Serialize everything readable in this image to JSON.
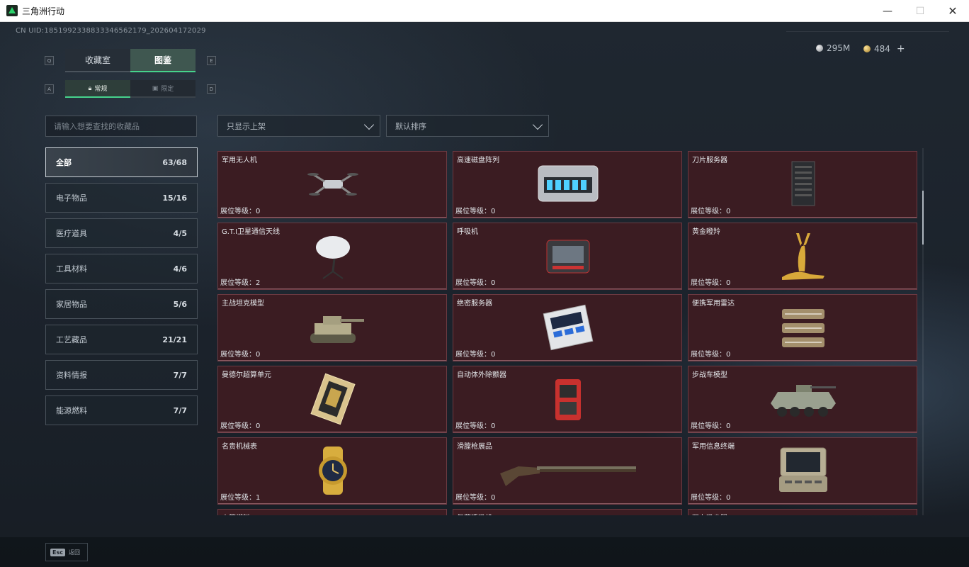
{
  "window": {
    "title": "三角洲行动",
    "min": "—",
    "max": "☐",
    "close": "✕"
  },
  "header": {
    "uid": "CN UID:1851992338833346562179_202604172029"
  },
  "currency": {
    "silver": "295M",
    "gold": "484",
    "plus": "+"
  },
  "keys": {
    "q": "Q",
    "e": "E",
    "a": "A",
    "d": "D"
  },
  "tabs": [
    {
      "label": "收藏室"
    },
    {
      "label": "图鉴"
    }
  ],
  "subtabs": [
    {
      "label": "常规",
      "icon": "lock-icon"
    },
    {
      "label": "限定",
      "icon": "image-icon"
    }
  ],
  "search": {
    "placeholder": "请输入想要查找的收藏品"
  },
  "filters": {
    "display": "只显示上架",
    "sort": "默认排序"
  },
  "categories": [
    {
      "label": "全部",
      "count": "63/68"
    },
    {
      "label": "电子物品",
      "count": "15/16"
    },
    {
      "label": "医疗道具",
      "count": "4/5"
    },
    {
      "label": "工具材料",
      "count": "4/6"
    },
    {
      "label": "家居物品",
      "count": "5/6"
    },
    {
      "label": "工艺藏品",
      "count": "21/21"
    },
    {
      "label": "资料情报",
      "count": "7/7"
    },
    {
      "label": "能源燃料",
      "count": "7/7"
    }
  ],
  "level_prefix": "展位等级：",
  "items": [
    {
      "name": "军用无人机",
      "level": "0",
      "icon": "drone-icon"
    },
    {
      "name": "高速磁盘阵列",
      "level": "0",
      "icon": "disk-array-icon"
    },
    {
      "name": "刀片服务器",
      "level": "0",
      "icon": "blade-server-icon"
    },
    {
      "name": "G.T.I卫星通信天线",
      "level": "2",
      "icon": "satellite-dish-icon"
    },
    {
      "name": "呼吸机",
      "level": "0",
      "icon": "ventilator-icon"
    },
    {
      "name": "黄金瞪羚",
      "level": "0",
      "icon": "gold-gazelle-icon"
    },
    {
      "name": "主战坦克模型",
      "level": "0",
      "icon": "tank-model-icon"
    },
    {
      "name": "绝密服务器",
      "level": "0",
      "icon": "secret-server-icon"
    },
    {
      "name": "便携军用雷达",
      "level": "0",
      "icon": "radar-icon"
    },
    {
      "name": "曼德尔超算单元",
      "level": "0",
      "icon": "supercomputer-unit-icon"
    },
    {
      "name": "自动体外除颤器",
      "level": "0",
      "icon": "defibrillator-icon"
    },
    {
      "name": "步战车模型",
      "level": "0",
      "icon": "ifv-model-icon"
    },
    {
      "name": "名贵机械表",
      "level": "1",
      "icon": "watch-icon"
    },
    {
      "name": "滑膛枪展品",
      "level": "0",
      "icon": "musket-icon"
    },
    {
      "name": "军用信息终端",
      "level": "0",
      "icon": "terminal-icon"
    },
    {
      "name": "火箭燃料",
      "level": "",
      "icon": "rocket-fuel-icon"
    },
    {
      "name": "复苏呼吸机",
      "level": "",
      "icon": "resuscitator-icon"
    },
    {
      "name": "强力吸尘器",
      "level": "",
      "icon": "vacuum-icon"
    }
  ],
  "footer": {
    "esc_key": "Esc",
    "esc_label": "返回"
  }
}
